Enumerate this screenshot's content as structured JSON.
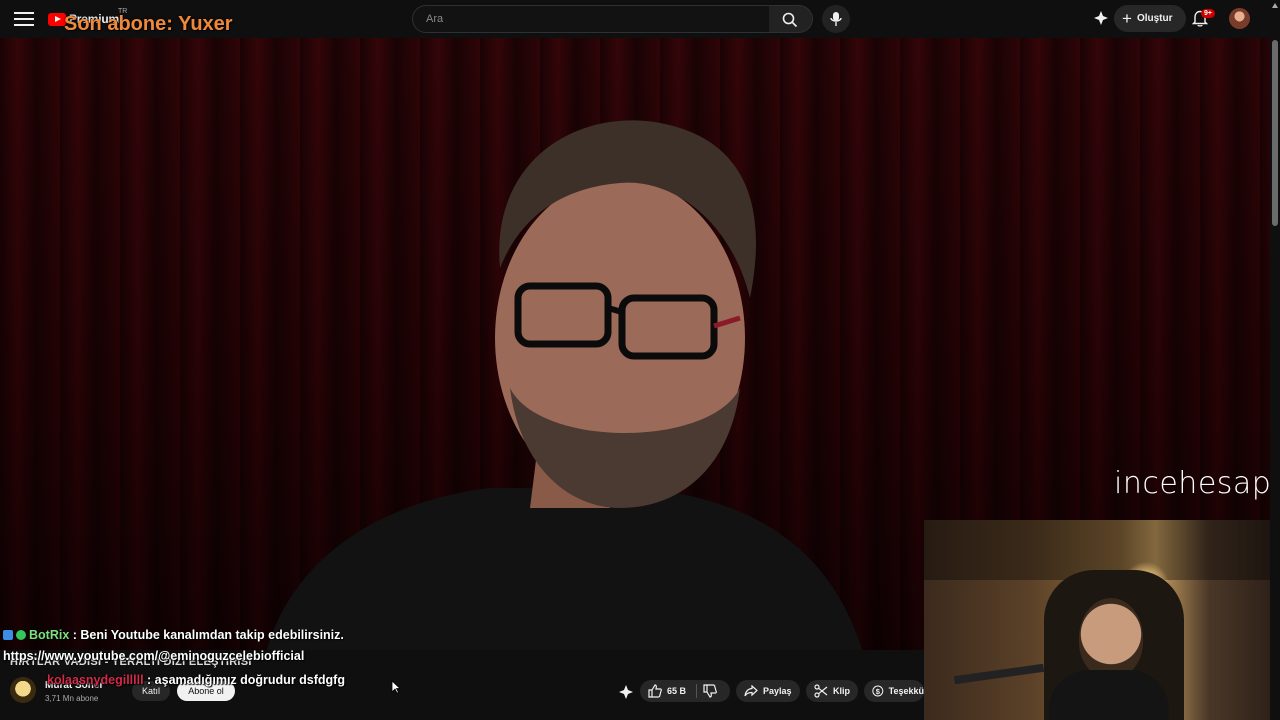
{
  "topbar": {
    "logo_text": "Premium",
    "logo_region": "TR",
    "search_placeholder": "Ara",
    "create_label": "Oluştur",
    "notification_count": "9+",
    "icons": [
      "menu-icon",
      "search-icon",
      "mic-icon",
      "sparkle-icon",
      "bell-icon"
    ]
  },
  "overlay": {
    "last_subscriber": "Son abone: Yuxer",
    "watermark": "incehesap"
  },
  "chat": {
    "lines": [
      {
        "user": "BotRix",
        "message": " : Beni Youtube kanalımdan takip edebilirsiniz."
      },
      {
        "user": "",
        "message": "https://www.youtube.com/@eminoguzcelebiofficial"
      },
      {
        "user": "kolaasnydegilllll",
        "message": " : aşamadığımız doğrudur dsfdgfg"
      }
    ],
    "background_title": "HIRTLAR VADİSİ - YERALTI DİZİ ELEŞTİRİSİ"
  },
  "channel": {
    "name": "Murat Soner",
    "subscribers": "3,71 Mn abone",
    "join_label": "Katıl",
    "subscribe_label": "Abone ol"
  },
  "actions": {
    "like_count": "65 B",
    "share_label": "Paylaş",
    "clip_label": "Klip",
    "thanks_label": "Teşekkü"
  },
  "colors": {
    "accent": "#ff0000",
    "background": "#0f0f0f",
    "overlay_text": "#f0893a",
    "chat_user1": "#7de07d",
    "chat_user2": "#d42a4a"
  }
}
